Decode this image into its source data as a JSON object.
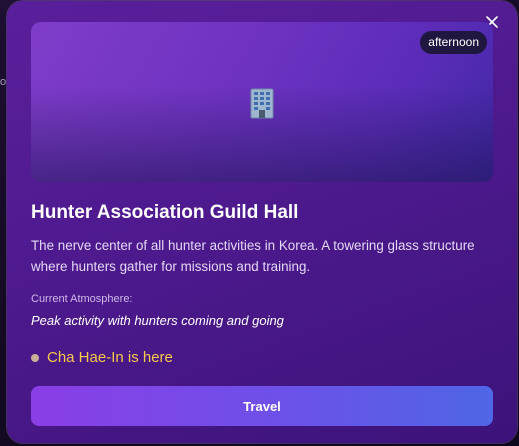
{
  "background": {
    "edge_text": "o"
  },
  "location": {
    "time_of_day": "afternoon",
    "icon": "office-building-icon",
    "name": "Hunter Association Guild Hall",
    "description": "The nerve center of all hunter activities in Korea. A towering glass structure where hunters gather for missions and training.",
    "atmosphere_label": "Current Atmosphere:",
    "atmosphere": "Peak activity with hunters coming and going",
    "presence": "Cha Hae-In is here"
  },
  "actions": {
    "travel_label": "Travel",
    "close_icon": "close-icon"
  },
  "colors": {
    "modal_bg": "#5a1f9c",
    "presence_text": "#f7c94a",
    "button_start": "#8a3ee6",
    "button_end": "#4f66e6",
    "badge_bg": "#1f1740"
  }
}
